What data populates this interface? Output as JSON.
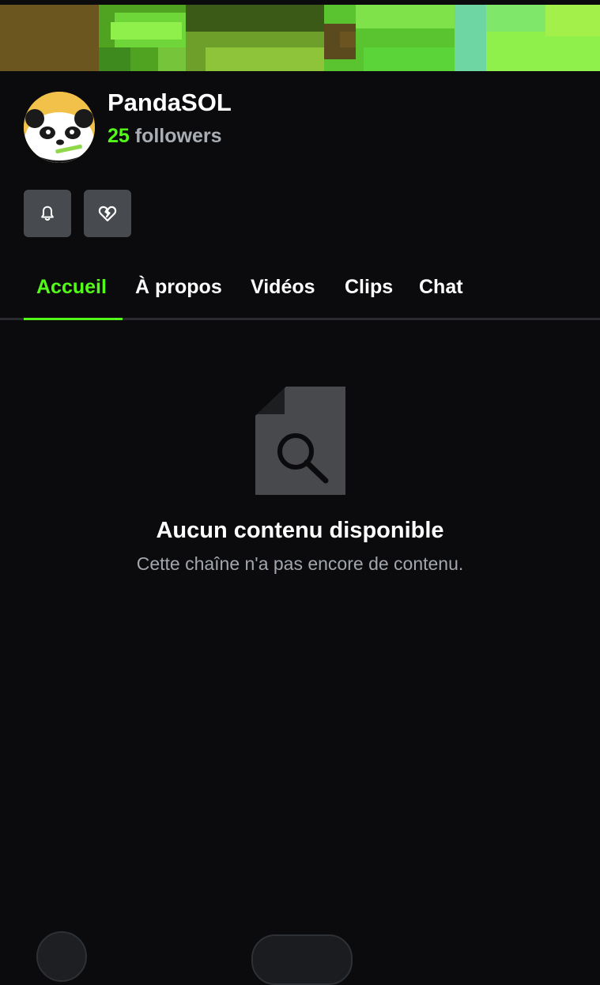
{
  "channel": {
    "name": "PandaSOL",
    "followers_count": "25",
    "followers_label": "followers"
  },
  "actions": {
    "bell_icon": "bell-icon",
    "heart_icon": "broken-heart-icon"
  },
  "tabs": [
    {
      "label": "Accueil",
      "active": true
    },
    {
      "label": "À propos",
      "active": false
    },
    {
      "label": "Vidéos",
      "active": false
    },
    {
      "label": "Clips",
      "active": false
    },
    {
      "label": "Chat",
      "active": false
    }
  ],
  "empty_state": {
    "icon": "document-search-icon",
    "title": "Aucun contenu disponible",
    "subtitle": "Cette chaîne n'a pas encore de contenu."
  },
  "colors": {
    "accent": "#53fc18",
    "background": "#0b0b0d",
    "button": "#474a4f",
    "muted_text": "#a2a6ad"
  }
}
